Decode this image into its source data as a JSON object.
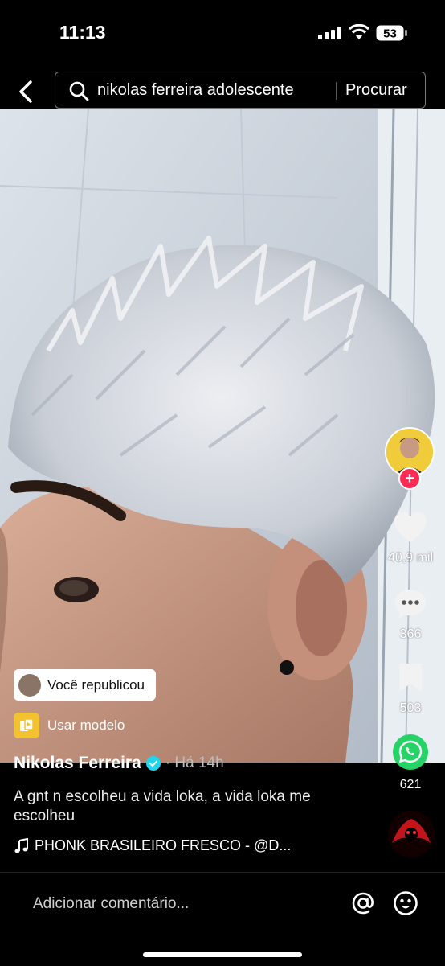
{
  "status_bar": {
    "time": "11:13",
    "battery": "53"
  },
  "search": {
    "query": "nikolas ferreira adolescente",
    "button": "Procurar"
  },
  "rail": {
    "likes": "40,9 mil",
    "comments": "366",
    "saves": "503",
    "shares": "621",
    "follow_symbol": "+"
  },
  "overlay": {
    "reposted": "Você republicou",
    "template": "Usar modelo"
  },
  "post": {
    "author": "Nikolas Ferreira",
    "time": "· Há 14h",
    "caption": "A gnt n escolheu a vida loka, a vida loka me escolheu",
    "music": "PHONK BRASILEIRO FRESCO - @D..."
  },
  "comment": {
    "placeholder": "Adicionar comentário..."
  },
  "colors": {
    "accent": "#fe2c55",
    "verified": "#20d5ec",
    "whatsapp": "#25d366",
    "template_icon": "#f2c230"
  }
}
